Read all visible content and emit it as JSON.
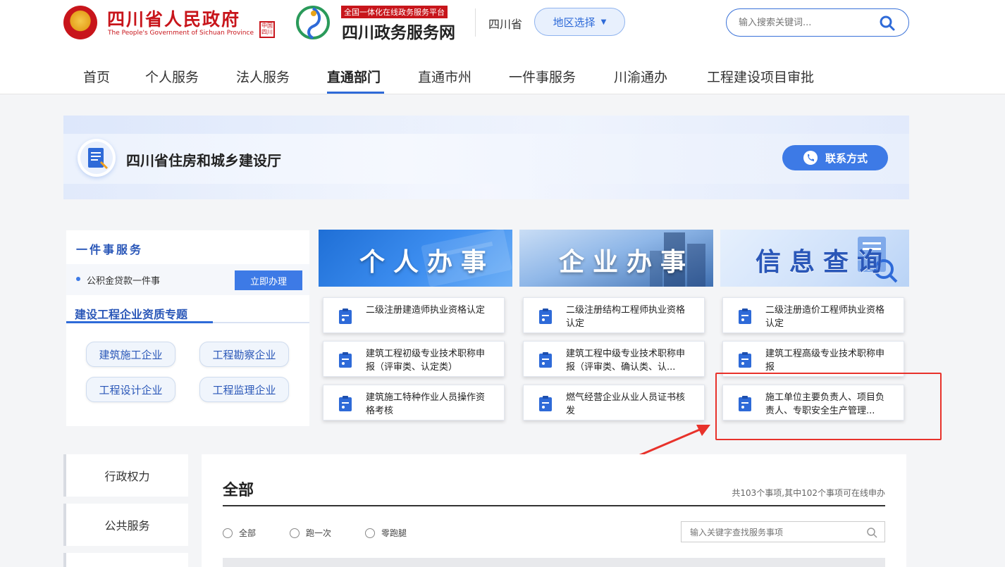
{
  "header": {
    "gov_title": "四川省人民政府",
    "gov_subtitle": "The People's Government of Sichuan Province",
    "seal_text": "中国四川",
    "platform_tag": "全国一体化在线政务服务平台",
    "platform_name": "四川政务服务网",
    "province": "四川省",
    "region_button": "地区选择",
    "search_placeholder": "输入搜索关键词..."
  },
  "nav": {
    "items": [
      {
        "label": "首页"
      },
      {
        "label": "个人服务"
      },
      {
        "label": "法人服务"
      },
      {
        "label": "直通部门"
      },
      {
        "label": "直通市州"
      },
      {
        "label": "一件事服务"
      },
      {
        "label": "川渝通办"
      },
      {
        "label": "工程建设项目审批"
      }
    ],
    "active": "直通部门"
  },
  "banner": {
    "department": "四川省住房和城乡建设厅",
    "contact_button": "联系方式"
  },
  "left_panel": {
    "yjs_title": "一件事服务",
    "yjs_item": "公积金贷款一件事",
    "yjs_button": "立即办理",
    "zz_title": "建设工程企业资质专题",
    "zz_buttons": [
      "建筑施工企业",
      "工程勘察企业",
      "工程设计企业",
      "工程监理企业"
    ]
  },
  "columns": [
    {
      "header": "个人办事",
      "cards": [
        "二级注册建造师执业资格认定",
        "建筑工程初级专业技术职称申报（评审类、认定类）",
        "建筑施工特种作业人员操作资格考核"
      ]
    },
    {
      "header": "企业办事",
      "cards": [
        "二级注册结构工程师执业资格认定",
        "建筑工程中级专业技术职称申报（评审类、确认类、认...",
        "燃气经营企业从业人员证书核发"
      ]
    },
    {
      "header": "信息查询",
      "cards": [
        "二级注册造价工程师执业资格认定",
        "建筑工程高级专业技术职称申报",
        "施工单位主要负责人、项目负责人、专职安全生产管理..."
      ]
    }
  ],
  "side_tabs": [
    "行政权力",
    "公共服务"
  ],
  "main": {
    "title": "全部",
    "count_text": "共103个事项,其中102个事项可在线申办",
    "radios": [
      "全部",
      "跑一次",
      "零跑腿"
    ],
    "filter_placeholder": "输入关键字查找服务事项"
  },
  "colors": {
    "brand_red": "#c8151b",
    "accent_blue": "#2e6ad8",
    "annotation_red": "#e8322b"
  }
}
